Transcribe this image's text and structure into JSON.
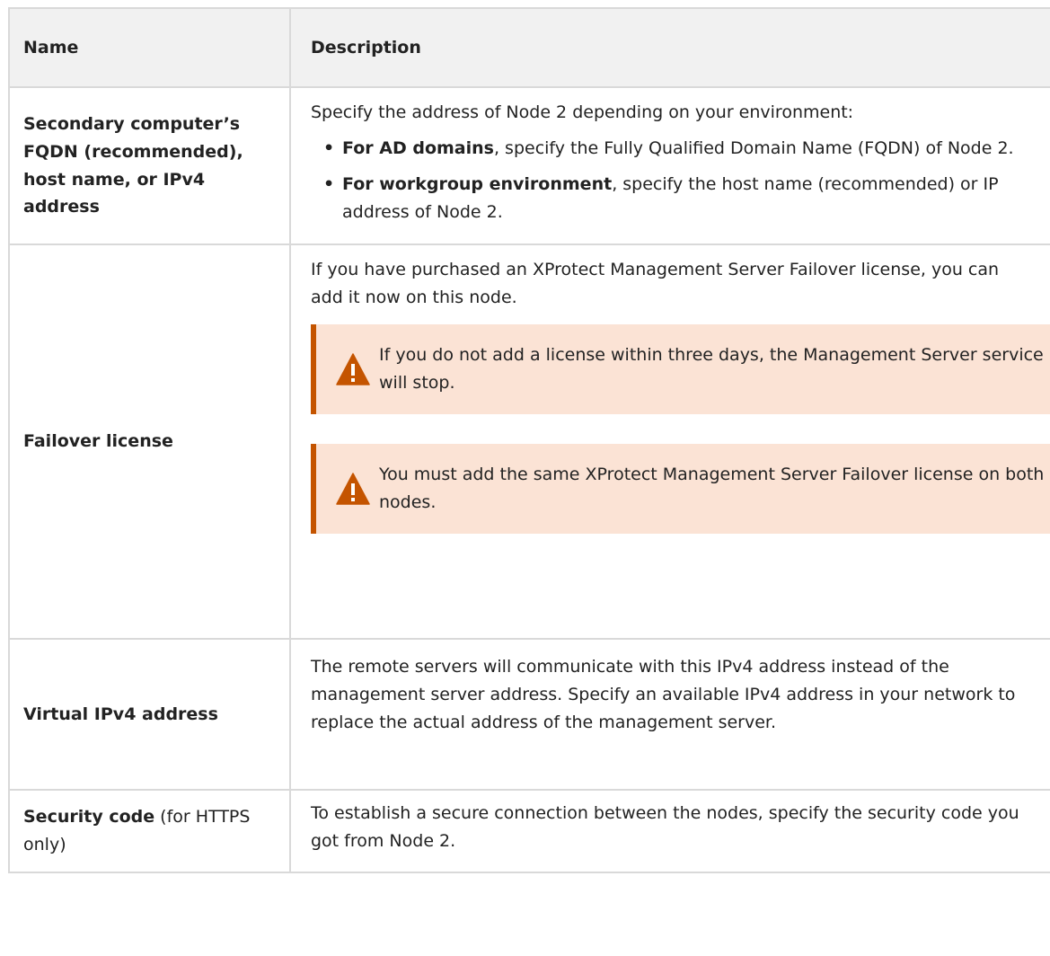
{
  "table": {
    "headers": {
      "name": "Name",
      "description": "Description"
    },
    "rows": [
      {
        "name": "Secondary computer’s FQDN (recommended), host name, or IPv4 address",
        "intro": "Specify the address of Node 2 depending on your environment:",
        "bullets": [
          {
            "strong": "For AD domains",
            "rest": ", specify the Fully Qualified Domain Name (FQDN) of Node 2."
          },
          {
            "strong": "For workgroup environment",
            "rest": ", specify the host name (recommended) or IP address of Node 2."
          }
        ]
      },
      {
        "name": "Failover license",
        "intro": "If you have purchased an XProtect Management Server Failover license, you can add it now on this node.",
        "warnings": [
          "If you do not add a license within three days, the Management Server service will stop.",
          "You must add the same XProtect Management Server Failover license on both nodes."
        ]
      },
      {
        "name": "Virtual IPv4 address",
        "text": "The remote servers will communicate with this IPv4 address instead of the management server address. Specify an available IPv4 address in your network to replace the actual address of the management server."
      },
      {
        "name_bold": "Security code",
        "name_rest": " (for HTTPS only)",
        "text": "To establish a secure connection between the nodes, specify the security code you got from Node 2."
      }
    ]
  },
  "icons": {
    "warning": "warning-triangle-icon"
  },
  "colors": {
    "header_bg": "#f1f1f1",
    "border": "#d9d9d9",
    "warning_bg": "#fbe3d5",
    "warning_accent": "#c45400"
  }
}
